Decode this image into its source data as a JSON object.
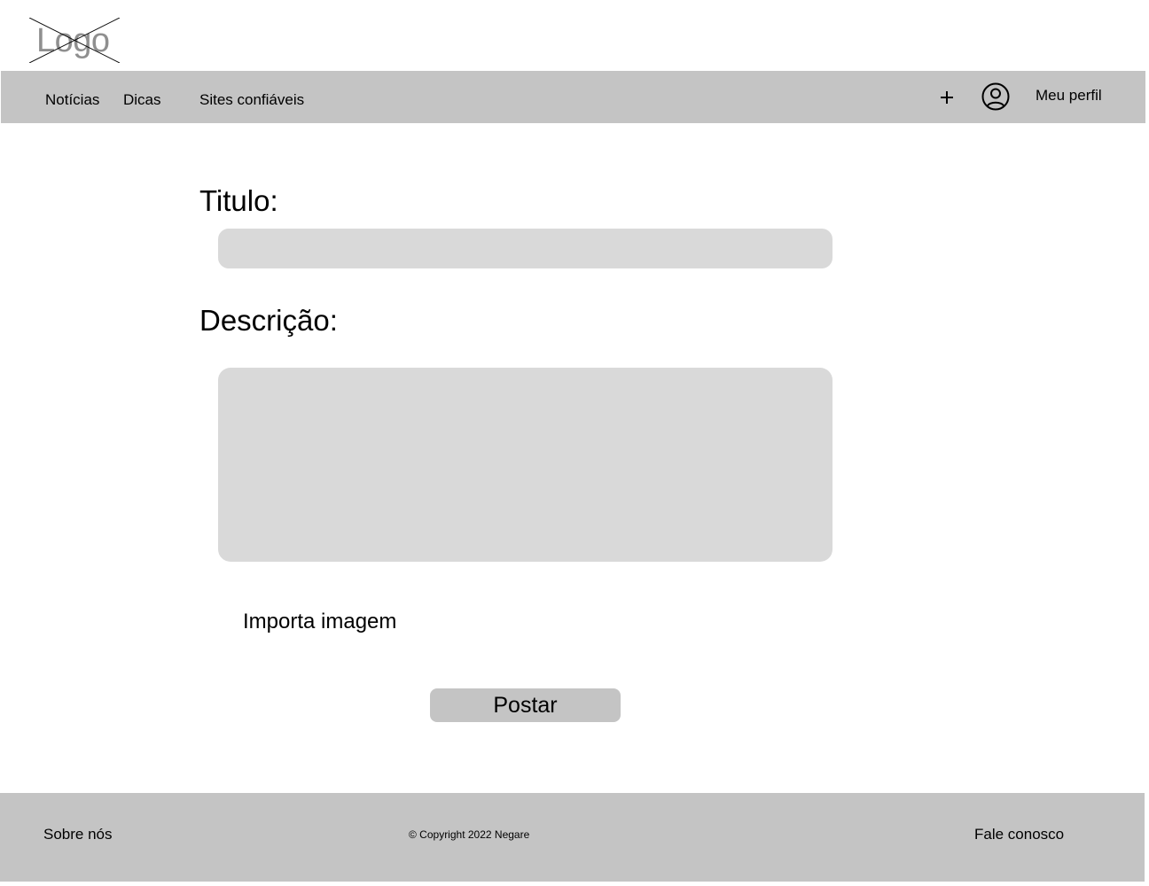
{
  "header": {
    "logo_text": "Logo"
  },
  "nav": {
    "links": [
      "Notícias",
      "Dicas",
      "Sites confiáveis"
    ],
    "profile_label": "Meu perfil",
    "icons": {
      "add": "plus-icon",
      "user": "user-circle-icon"
    }
  },
  "form": {
    "title_label": "Titulo:",
    "title_value": "",
    "description_label": "Descrição:",
    "description_value": "",
    "import_image_label": "Importa imagem",
    "submit_label": "Postar"
  },
  "footer": {
    "about": "Sobre nós",
    "copyright": "© Copyright 2022 Negare",
    "contact": "Fale conosco"
  },
  "colors": {
    "bar_background": "#c4c4c4",
    "input_background": "#d9d9d9",
    "logo_text": "#8f8f8f"
  }
}
